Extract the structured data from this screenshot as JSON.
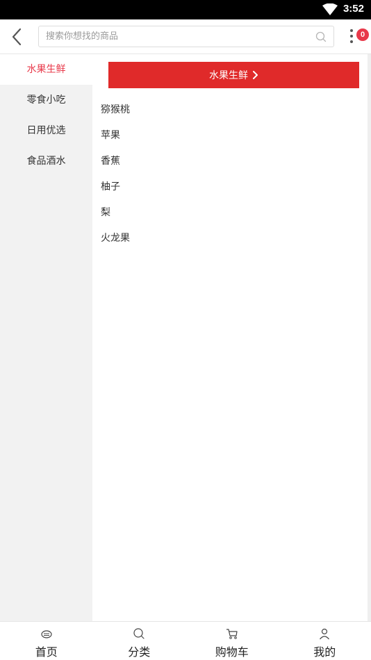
{
  "status_bar": {
    "time": "3:52"
  },
  "header": {
    "search_placeholder": "搜索你想找的商品",
    "cart_badge": "0"
  },
  "sidebar": {
    "items": [
      {
        "label": "水果生鲜",
        "active": true
      },
      {
        "label": "零食小吃",
        "active": false
      },
      {
        "label": "日用优选",
        "active": false
      },
      {
        "label": "食品酒水",
        "active": false
      }
    ]
  },
  "content": {
    "category_title": "水果生鲜",
    "subcategories": [
      "猕猴桃",
      "苹果",
      "香蕉",
      "柚子",
      "梨",
      "火龙果"
    ]
  },
  "tabbar": {
    "tabs": [
      {
        "label": "首页",
        "icon": "home-icon"
      },
      {
        "label": "分类",
        "icon": "search-icon"
      },
      {
        "label": "购物车",
        "icon": "cart-icon"
      },
      {
        "label": "我的",
        "icon": "user-icon"
      }
    ]
  },
  "colors": {
    "accent": "#e8394a",
    "banner": "#e02a2a",
    "sidebar_bg": "#f2f2f2"
  }
}
